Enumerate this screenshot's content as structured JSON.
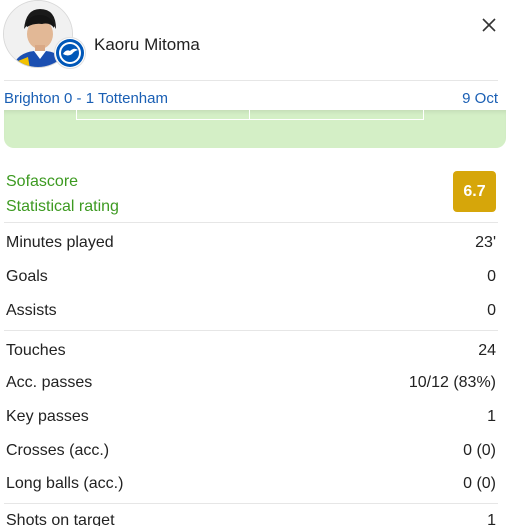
{
  "header": {
    "player_name": "Kaoru Mitoma"
  },
  "match": {
    "title": "Brighton 0 - 1 Tottenham",
    "date": "9 Oct"
  },
  "rating": {
    "line1": "Sofascore",
    "line2": "Statistical rating",
    "value": "6.7"
  },
  "stats": {
    "minutes_played": {
      "label": "Minutes played",
      "value": "23'"
    },
    "goals": {
      "label": "Goals",
      "value": "0"
    },
    "assists": {
      "label": "Assists",
      "value": "0"
    },
    "touches": {
      "label": "Touches",
      "value": "24"
    },
    "acc_passes": {
      "label": "Acc. passes",
      "value": "10/12 (83%)"
    },
    "key_passes": {
      "label": "Key passes",
      "value": "1"
    },
    "crosses": {
      "label": "Crosses (acc.)",
      "value": "0 (0)"
    },
    "long_balls": {
      "label": "Long balls (acc.)",
      "value": "0 (0)"
    },
    "shots_on_target": {
      "label": "Shots on target",
      "value": "1"
    }
  },
  "colors": {
    "link": "#1a5fb4",
    "rating_green": "#3d9a21",
    "rating_badge": "#d6a60a",
    "heatmap_bg": "#d4efc6"
  }
}
